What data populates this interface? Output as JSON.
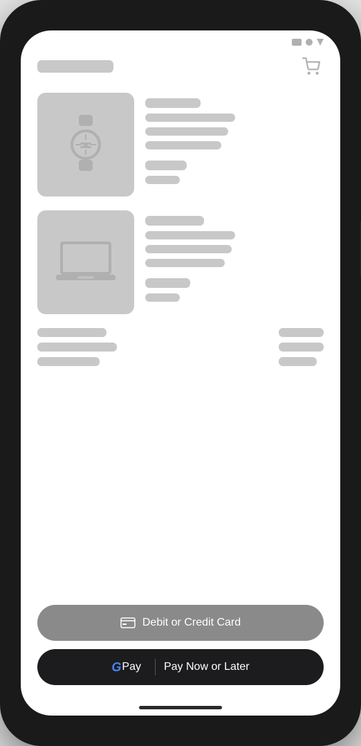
{
  "status_bar": {
    "icons": [
      "square",
      "circle",
      "triangle"
    ]
  },
  "header": {
    "title_bar_width": 100,
    "cart_icon": "cart-icon"
  },
  "products": [
    {
      "id": "product-1",
      "image_type": "watch",
      "detail_bars": [
        60,
        100,
        90,
        50,
        40
      ]
    },
    {
      "id": "product-2",
      "image_type": "laptop",
      "detail_bars": [
        70,
        110,
        95,
        55,
        40
      ]
    }
  ],
  "summary": {
    "left_bars": [
      90,
      100,
      80
    ],
    "right_bars": [
      60,
      60,
      50
    ]
  },
  "buttons": {
    "debit_label": "Debit or Credit Card",
    "gpay_g": "G",
    "gpay_pay": "Pay",
    "gpay_divider": "|",
    "gpay_action": "Pay Now or Later"
  }
}
